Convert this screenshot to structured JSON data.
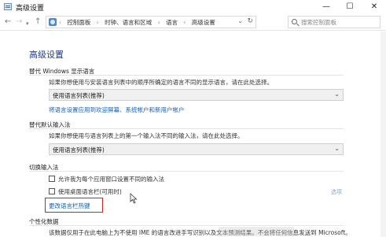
{
  "window": {
    "title": "高级设置",
    "minimize": "—",
    "maximize": "☐",
    "close": "✕"
  },
  "nav": {
    "back": "←",
    "forward": "→",
    "recent": "▾",
    "up": "↑",
    "breadcrumbs": [
      "控制面板",
      "时钟、语言和区域",
      "语言",
      "高级设置"
    ],
    "breadcrumb_separator": "›",
    "dropdown": "⌄",
    "refresh": "↻",
    "search_placeholder": "搜索控制面板"
  },
  "main": {
    "title": "高级设置",
    "sections": {
      "override_display": {
        "heading": "替代 Windows 显示语言",
        "description": "如果你想使用与安装语言列表中的顺序所确定的语言不同的显示语言，请在此处选择。",
        "select_value": "使用语言列表(推荐)",
        "link": "将语言设置应用到欢迎屏幕、系统帐户和新用户帐户"
      },
      "override_input": {
        "heading": "替代默认输入法",
        "description": "如果你想使用与语言列表上的第一个输入法不同的输入法，请在此处选择。",
        "select_value": "使用语言列表(推荐)"
      },
      "switch_input": {
        "heading": "切换输入法",
        "checkbox1": "允许我为每个应用窗口设置不同的输入法",
        "checkbox2": "使用桌面语言栏(可用时)",
        "options_link": "选项",
        "hotkey_link": "更改语言栏热键"
      },
      "personalization": {
        "heading": "个性化数据",
        "description": "该数据仅用于在此电脑上为不使用 IME 的语言改进手写识别以及文本预测结果。不会将任何信息发送到 Microsoft。"
      }
    }
  },
  "colors": {
    "title_blue": "#1e3a8c",
    "link_blue": "#1a5fb4",
    "highlight_red": "#d32020"
  }
}
